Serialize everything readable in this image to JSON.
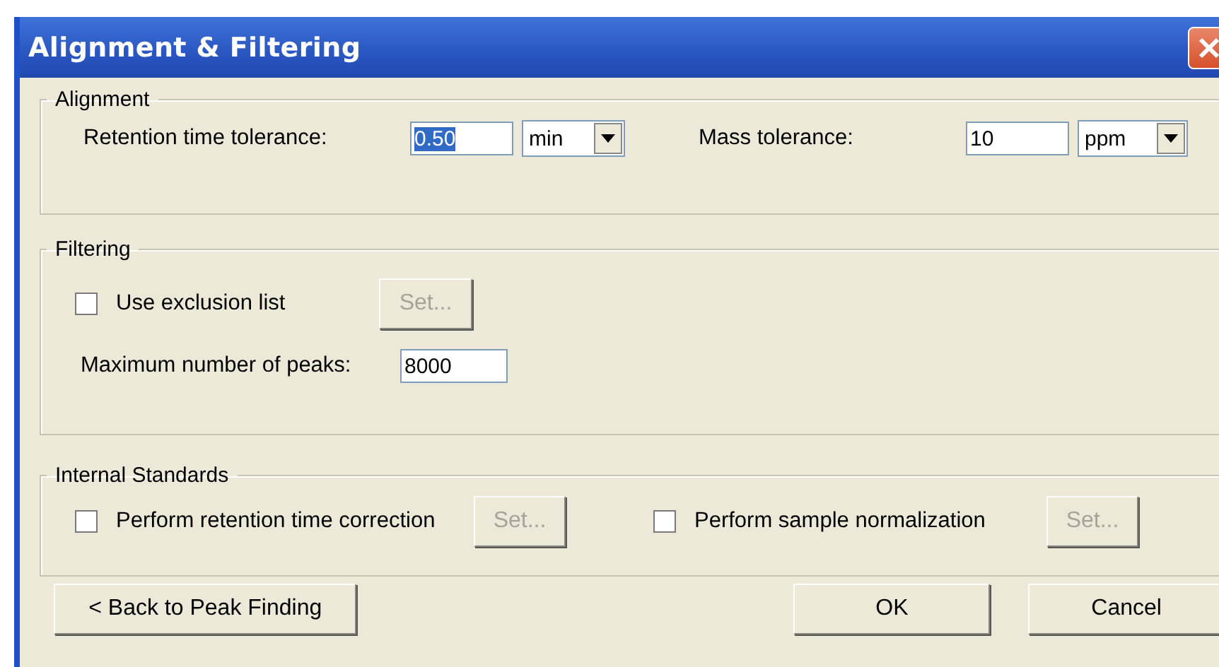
{
  "window": {
    "title": "Alignment & Filtering"
  },
  "alignment": {
    "legend": "Alignment",
    "fields": [
      {
        "label": "Retention time tolerance:",
        "value": "0.50",
        "text_selected": true,
        "unit": "min"
      },
      {
        "label": "Mass tolerance:",
        "value": "10",
        "text_selected": false,
        "unit": "ppm"
      }
    ]
  },
  "filtering": {
    "legend": "Filtering",
    "exclusion": {
      "label": "Use exclusion list",
      "checked": false,
      "button": {
        "label": "Set...",
        "disabled": true
      }
    },
    "max_peaks": {
      "label": "Maximum number of peaks:",
      "value": "8000"
    }
  },
  "internal_standards": {
    "legend": "Internal Standards",
    "options": [
      {
        "label": "Perform retention time correction",
        "checked": false,
        "button": {
          "label": "Set...",
          "disabled": true
        }
      },
      {
        "label": "Perform sample normalization",
        "checked": false,
        "button": {
          "label": "Set...",
          "disabled": true
        }
      }
    ]
  },
  "buttons": [
    {
      "label": "< Back to Peak Finding"
    },
    {
      "label": "OK"
    },
    {
      "label": "Cancel"
    }
  ]
}
